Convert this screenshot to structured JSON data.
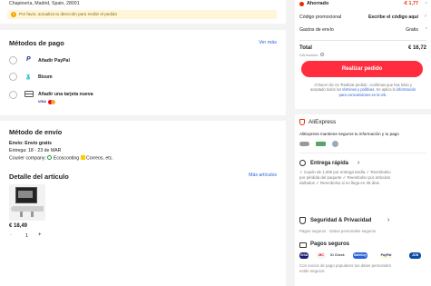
{
  "address": {
    "line": "Chapinería, Madrid, Spain, 28001",
    "warning": "Por favor, actualiza tu dirección para recibir el pedido"
  },
  "payment": {
    "title": "Métodos de pago",
    "more": "Ver más",
    "options": [
      {
        "label": "Añadir PayPal"
      },
      {
        "label": "Bizum"
      },
      {
        "label": "Añadir una tarjeta nueva"
      }
    ],
    "card_logos": [
      "VISA",
      "MC"
    ]
  },
  "shipping": {
    "title": "Método de envío",
    "method": "Envío: Envío gratis",
    "delivery": "Entrega: 18 - 23 de MAR",
    "courier_prefix": "Courier company:",
    "courier_1": "Ecoscooting",
    "courier_2": "Correos",
    "courier_suffix": ", etc."
  },
  "items": {
    "title": "Detalle del artículo",
    "more": "Más artículos",
    "price": "€ 18,49",
    "qty_minus": "−",
    "qty": "1",
    "qty_plus": "+"
  },
  "summary": {
    "saved_label": "Ahorrado",
    "saved_value": "-€ 1,77",
    "promo_label": "Código promocional",
    "promo_value": "Escribe el código aquí",
    "shipping_label": "Gastos de envío",
    "shipping_value": "Gratis",
    "total_label": "Total",
    "total_value": "€ 16,72",
    "total_sub": "IVA incluido",
    "cta": "Realizar pedido",
    "legal_1": "Al hacer clic en 'Realizar pedido', confirmas que has leído y",
    "legal_2": "aceptado todos los",
    "legal_link1": "términos y políticas",
    "legal_3": ". Se aplica la",
    "legal_link2": "información",
    "legal_link3": "para consumidores en la UE."
  },
  "trust": {
    "brand": "AliExpress",
    "desc": "AliExpress mantiene seguros tu información y tu pago",
    "fast_title": "Entrega rápida",
    "fast_line1": "Cupón de 1,00€ por entrega tardía",
    "fast_line1b": "Reembolso",
    "fast_line2": "por pérdida del paquete",
    "fast_line2b": "Reembolso por artículos",
    "fast_line3": "dañados",
    "fast_line3b": "Reembolso si no llega en 35 días",
    "sec_title": "Seguridad & Privacidad",
    "sec_sub": "Pagos seguros · Datos personales seguros",
    "pay_title": "Pagos seguros",
    "pay_sub1": "Con socios de pago populares tus datos personales",
    "pay_sub2": "están seguros",
    "pay_logos": [
      "VISA",
      "MC",
      "ID Check",
      "SafeKey",
      "PayPal",
      "JCB"
    ],
    "chev": "›"
  },
  "colors": {
    "brand": "#ff2d3d",
    "accent_red": "#e62e04",
    "link": "#2a63d6",
    "green": "#1a9b3d"
  }
}
